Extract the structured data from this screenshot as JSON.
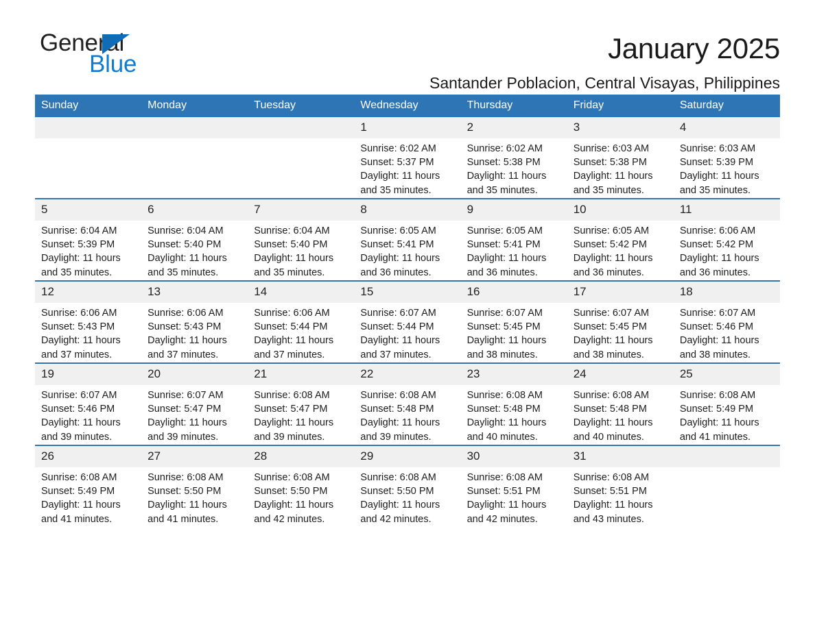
{
  "brand": {
    "name_part1": "General",
    "name_part2": "Blue",
    "triangle_icon": "triangle-icon",
    "accent_color": "#0f7cd4"
  },
  "header": {
    "title": "January 2025",
    "location": "Santander Poblacion, Central Visayas, Philippines"
  },
  "calendar": {
    "header_bg": "#2e75b6",
    "daynum_bg": "#f0f0f0",
    "weekdays": [
      "Sunday",
      "Monday",
      "Tuesday",
      "Wednesday",
      "Thursday",
      "Friday",
      "Saturday"
    ],
    "weeks": [
      [
        {
          "day": "",
          "sunrise": "",
          "sunset": "",
          "daylight_line1": "",
          "daylight_line2": ""
        },
        {
          "day": "",
          "sunrise": "",
          "sunset": "",
          "daylight_line1": "",
          "daylight_line2": ""
        },
        {
          "day": "",
          "sunrise": "",
          "sunset": "",
          "daylight_line1": "",
          "daylight_line2": ""
        },
        {
          "day": "1",
          "sunrise": "Sunrise: 6:02 AM",
          "sunset": "Sunset: 5:37 PM",
          "daylight_line1": "Daylight: 11 hours",
          "daylight_line2": "and 35 minutes."
        },
        {
          "day": "2",
          "sunrise": "Sunrise: 6:02 AM",
          "sunset": "Sunset: 5:38 PM",
          "daylight_line1": "Daylight: 11 hours",
          "daylight_line2": "and 35 minutes."
        },
        {
          "day": "3",
          "sunrise": "Sunrise: 6:03 AM",
          "sunset": "Sunset: 5:38 PM",
          "daylight_line1": "Daylight: 11 hours",
          "daylight_line2": "and 35 minutes."
        },
        {
          "day": "4",
          "sunrise": "Sunrise: 6:03 AM",
          "sunset": "Sunset: 5:39 PM",
          "daylight_line1": "Daylight: 11 hours",
          "daylight_line2": "and 35 minutes."
        }
      ],
      [
        {
          "day": "5",
          "sunrise": "Sunrise: 6:04 AM",
          "sunset": "Sunset: 5:39 PM",
          "daylight_line1": "Daylight: 11 hours",
          "daylight_line2": "and 35 minutes."
        },
        {
          "day": "6",
          "sunrise": "Sunrise: 6:04 AM",
          "sunset": "Sunset: 5:40 PM",
          "daylight_line1": "Daylight: 11 hours",
          "daylight_line2": "and 35 minutes."
        },
        {
          "day": "7",
          "sunrise": "Sunrise: 6:04 AM",
          "sunset": "Sunset: 5:40 PM",
          "daylight_line1": "Daylight: 11 hours",
          "daylight_line2": "and 35 minutes."
        },
        {
          "day": "8",
          "sunrise": "Sunrise: 6:05 AM",
          "sunset": "Sunset: 5:41 PM",
          "daylight_line1": "Daylight: 11 hours",
          "daylight_line2": "and 36 minutes."
        },
        {
          "day": "9",
          "sunrise": "Sunrise: 6:05 AM",
          "sunset": "Sunset: 5:41 PM",
          "daylight_line1": "Daylight: 11 hours",
          "daylight_line2": "and 36 minutes."
        },
        {
          "day": "10",
          "sunrise": "Sunrise: 6:05 AM",
          "sunset": "Sunset: 5:42 PM",
          "daylight_line1": "Daylight: 11 hours",
          "daylight_line2": "and 36 minutes."
        },
        {
          "day": "11",
          "sunrise": "Sunrise: 6:06 AM",
          "sunset": "Sunset: 5:42 PM",
          "daylight_line1": "Daylight: 11 hours",
          "daylight_line2": "and 36 minutes."
        }
      ],
      [
        {
          "day": "12",
          "sunrise": "Sunrise: 6:06 AM",
          "sunset": "Sunset: 5:43 PM",
          "daylight_line1": "Daylight: 11 hours",
          "daylight_line2": "and 37 minutes."
        },
        {
          "day": "13",
          "sunrise": "Sunrise: 6:06 AM",
          "sunset": "Sunset: 5:43 PM",
          "daylight_line1": "Daylight: 11 hours",
          "daylight_line2": "and 37 minutes."
        },
        {
          "day": "14",
          "sunrise": "Sunrise: 6:06 AM",
          "sunset": "Sunset: 5:44 PM",
          "daylight_line1": "Daylight: 11 hours",
          "daylight_line2": "and 37 minutes."
        },
        {
          "day": "15",
          "sunrise": "Sunrise: 6:07 AM",
          "sunset": "Sunset: 5:44 PM",
          "daylight_line1": "Daylight: 11 hours",
          "daylight_line2": "and 37 minutes."
        },
        {
          "day": "16",
          "sunrise": "Sunrise: 6:07 AM",
          "sunset": "Sunset: 5:45 PM",
          "daylight_line1": "Daylight: 11 hours",
          "daylight_line2": "and 38 minutes."
        },
        {
          "day": "17",
          "sunrise": "Sunrise: 6:07 AM",
          "sunset": "Sunset: 5:45 PM",
          "daylight_line1": "Daylight: 11 hours",
          "daylight_line2": "and 38 minutes."
        },
        {
          "day": "18",
          "sunrise": "Sunrise: 6:07 AM",
          "sunset": "Sunset: 5:46 PM",
          "daylight_line1": "Daylight: 11 hours",
          "daylight_line2": "and 38 minutes."
        }
      ],
      [
        {
          "day": "19",
          "sunrise": "Sunrise: 6:07 AM",
          "sunset": "Sunset: 5:46 PM",
          "daylight_line1": "Daylight: 11 hours",
          "daylight_line2": "and 39 minutes."
        },
        {
          "day": "20",
          "sunrise": "Sunrise: 6:07 AM",
          "sunset": "Sunset: 5:47 PM",
          "daylight_line1": "Daylight: 11 hours",
          "daylight_line2": "and 39 minutes."
        },
        {
          "day": "21",
          "sunrise": "Sunrise: 6:08 AM",
          "sunset": "Sunset: 5:47 PM",
          "daylight_line1": "Daylight: 11 hours",
          "daylight_line2": "and 39 minutes."
        },
        {
          "day": "22",
          "sunrise": "Sunrise: 6:08 AM",
          "sunset": "Sunset: 5:48 PM",
          "daylight_line1": "Daylight: 11 hours",
          "daylight_line2": "and 39 minutes."
        },
        {
          "day": "23",
          "sunrise": "Sunrise: 6:08 AM",
          "sunset": "Sunset: 5:48 PM",
          "daylight_line1": "Daylight: 11 hours",
          "daylight_line2": "and 40 minutes."
        },
        {
          "day": "24",
          "sunrise": "Sunrise: 6:08 AM",
          "sunset": "Sunset: 5:48 PM",
          "daylight_line1": "Daylight: 11 hours",
          "daylight_line2": "and 40 minutes."
        },
        {
          "day": "25",
          "sunrise": "Sunrise: 6:08 AM",
          "sunset": "Sunset: 5:49 PM",
          "daylight_line1": "Daylight: 11 hours",
          "daylight_line2": "and 41 minutes."
        }
      ],
      [
        {
          "day": "26",
          "sunrise": "Sunrise: 6:08 AM",
          "sunset": "Sunset: 5:49 PM",
          "daylight_line1": "Daylight: 11 hours",
          "daylight_line2": "and 41 minutes."
        },
        {
          "day": "27",
          "sunrise": "Sunrise: 6:08 AM",
          "sunset": "Sunset: 5:50 PM",
          "daylight_line1": "Daylight: 11 hours",
          "daylight_line2": "and 41 minutes."
        },
        {
          "day": "28",
          "sunrise": "Sunrise: 6:08 AM",
          "sunset": "Sunset: 5:50 PM",
          "daylight_line1": "Daylight: 11 hours",
          "daylight_line2": "and 42 minutes."
        },
        {
          "day": "29",
          "sunrise": "Sunrise: 6:08 AM",
          "sunset": "Sunset: 5:50 PM",
          "daylight_line1": "Daylight: 11 hours",
          "daylight_line2": "and 42 minutes."
        },
        {
          "day": "30",
          "sunrise": "Sunrise: 6:08 AM",
          "sunset": "Sunset: 5:51 PM",
          "daylight_line1": "Daylight: 11 hours",
          "daylight_line2": "and 42 minutes."
        },
        {
          "day": "31",
          "sunrise": "Sunrise: 6:08 AM",
          "sunset": "Sunset: 5:51 PM",
          "daylight_line1": "Daylight: 11 hours",
          "daylight_line2": "and 43 minutes."
        },
        {
          "day": "",
          "sunrise": "",
          "sunset": "",
          "daylight_line1": "",
          "daylight_line2": ""
        }
      ]
    ]
  }
}
